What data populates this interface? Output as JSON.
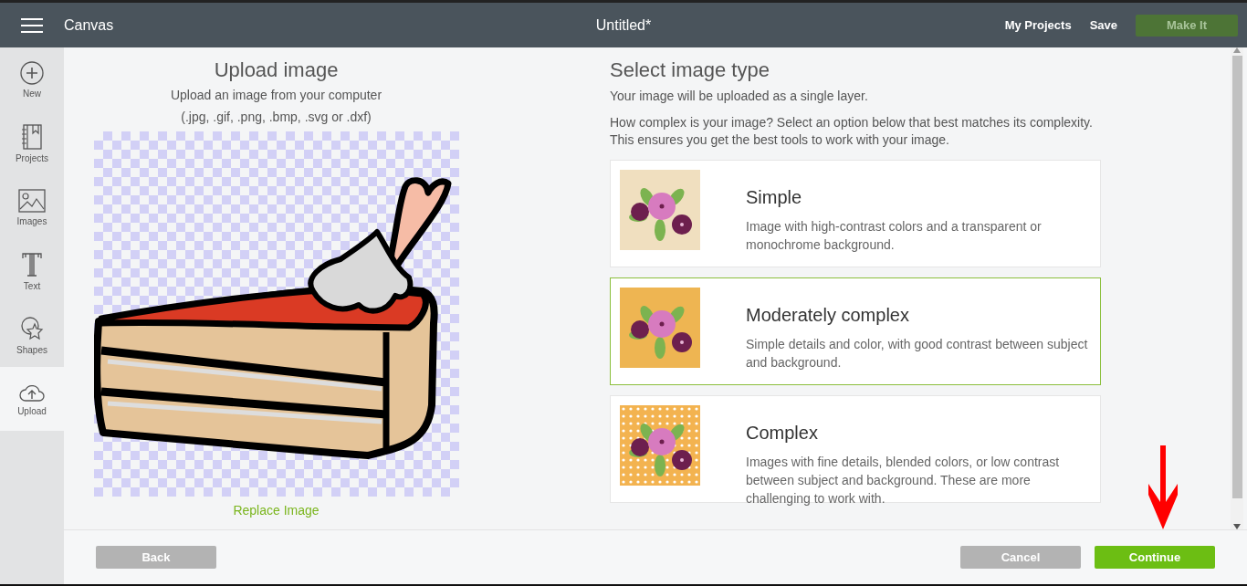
{
  "header": {
    "app_name": "Canvas",
    "title": "Untitled*",
    "links": [
      "My Projects",
      "Save"
    ],
    "make_it": {
      "label": "Make It",
      "disabled": true
    }
  },
  "sidebar": {
    "items": [
      {
        "kind": "new",
        "label": "New",
        "selected": false
      },
      {
        "kind": "projects",
        "label": "Projects",
        "selected": false
      },
      {
        "kind": "images",
        "label": "Images",
        "selected": false
      },
      {
        "kind": "text",
        "label": "Text",
        "selected": false
      },
      {
        "kind": "shapes",
        "label": "Shapes",
        "selected": false
      },
      {
        "kind": "upload",
        "label": "Upload",
        "selected": true
      }
    ]
  },
  "upload": {
    "title": "Upload image",
    "subtitle": "Upload an image from your computer",
    "formats": "(.jpg, .gif, .png, .bmp, .svg or .dxf)",
    "replace_link": "Replace Image"
  },
  "image_type": {
    "title": "Select image type",
    "note": "Your image will be uploaded as a single layer.",
    "question": "How complex is your image? Select an option below that best matches its complexity. This ensures you get the best tools to work with your image.",
    "options": [
      {
        "title": "Simple",
        "description": "Image with high-contrast colors and a transparent or monochrome background.",
        "selected": false,
        "kind": "plain",
        "color": "#f0dfbf"
      },
      {
        "title": "Moderately complex",
        "description": "Simple details and color, with good contrast between subject and background.",
        "selected": true,
        "kind": "plain",
        "color": "#eeb552"
      },
      {
        "title": "Complex",
        "description": "Images with fine details, blended colors, or low contrast between subject and background. These are more challenging to work with.",
        "selected": false,
        "kind": "dotted",
        "color": "#f3b350"
      }
    ]
  },
  "footer": {
    "back": "Back",
    "cancel": "Cancel",
    "continue": "Continue"
  }
}
